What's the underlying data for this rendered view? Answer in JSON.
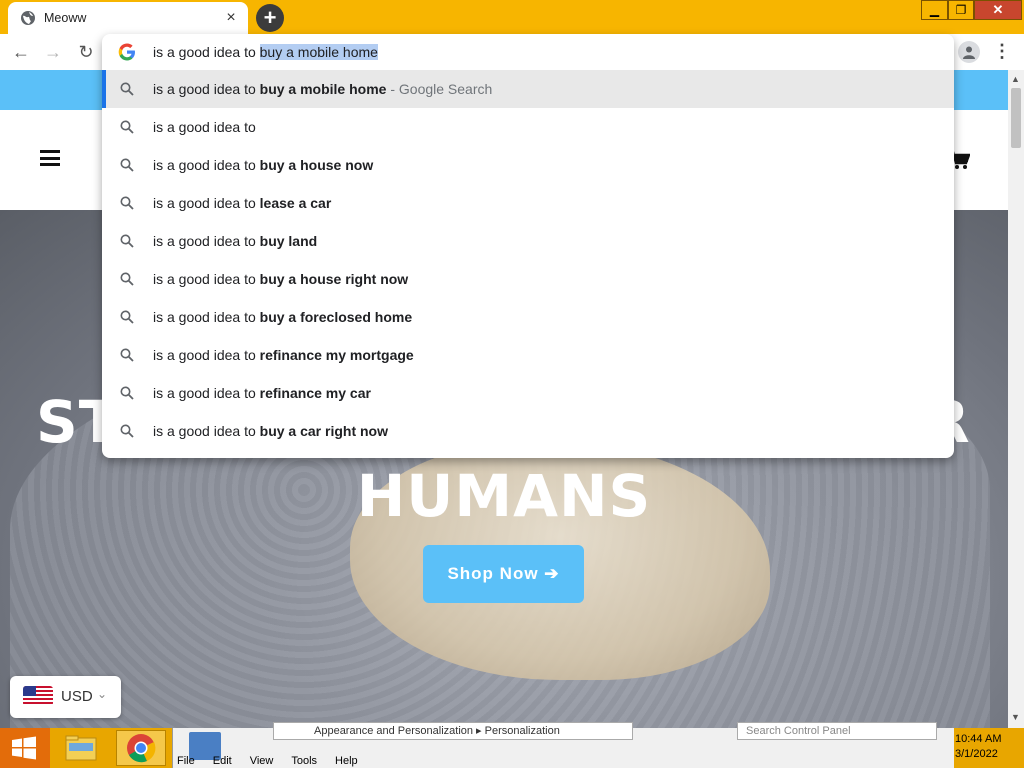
{
  "browser": {
    "tab_title": "Meoww",
    "tab_close": "×",
    "new_tab": "+",
    "window_controls": {
      "minimize": "▁",
      "maximize": "❐",
      "close": "✕"
    },
    "nav": {
      "back": "←",
      "forward": "→",
      "reload": "↻",
      "menu": "⋮"
    }
  },
  "omnibox": {
    "typed_text": "is a good idea to ",
    "autocomplete_text": "buy a mobile home",
    "suggestions": [
      {
        "prefix": "is a good idea to ",
        "bold": "buy a mobile home",
        "hint": " - Google Search",
        "active": true
      },
      {
        "prefix": "is a good idea to",
        "bold": "",
        "hint": ""
      },
      {
        "prefix": "is a good idea to ",
        "bold": "buy a house now",
        "hint": ""
      },
      {
        "prefix": "is a good idea to ",
        "bold": "lease a car",
        "hint": ""
      },
      {
        "prefix": "is a good idea to ",
        "bold": "buy land",
        "hint": ""
      },
      {
        "prefix": "is a good idea to ",
        "bold": "buy a house right now",
        "hint": ""
      },
      {
        "prefix": "is a good idea to ",
        "bold": "buy a foreclosed home",
        "hint": ""
      },
      {
        "prefix": "is a good idea to ",
        "bold": "refinance my mortgage",
        "hint": ""
      },
      {
        "prefix": "is a good idea to ",
        "bold": "refinance my car",
        "hint": ""
      },
      {
        "prefix": "is a good idea to ",
        "bold": "buy a car right now",
        "hint": ""
      }
    ]
  },
  "page": {
    "hero_left_fragment": "ST",
    "hero_right_fragment": "R",
    "hero_line_2": "HUMANS",
    "shop_button": "Shop Now ➔",
    "currency_code": "USD",
    "currency_chevron": "⌄",
    "cart_icon": "cart-icon",
    "accent_color": "#5bc0f8"
  },
  "taskbar": {
    "control_panel_path": "Appearance and Personalization  ▸  Personalization",
    "control_panel_search_placeholder": "Search Control Panel",
    "menu": [
      "File",
      "Edit",
      "View",
      "Tools",
      "Help"
    ],
    "clock_time": "10:44 AM",
    "clock_date": "3/1/2022"
  }
}
